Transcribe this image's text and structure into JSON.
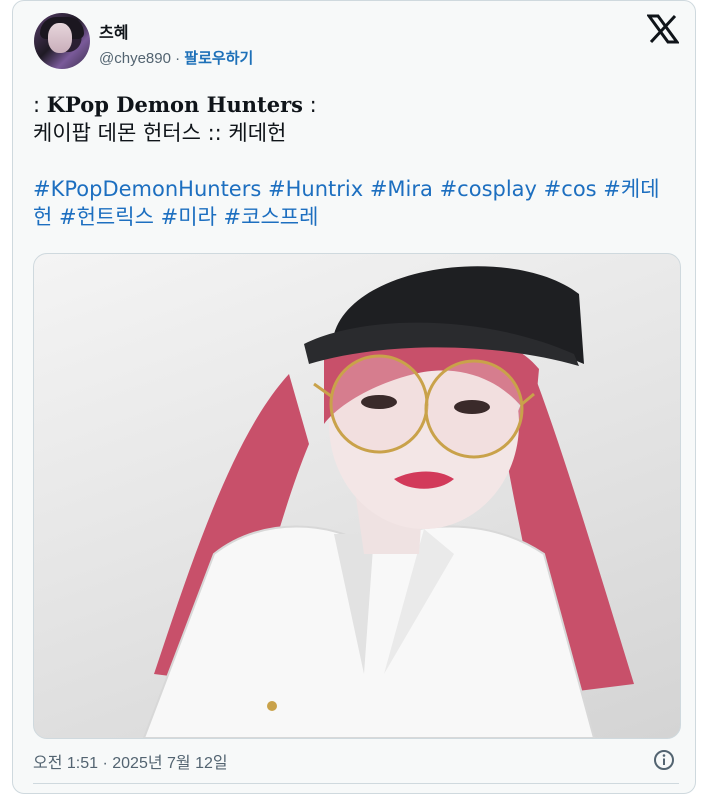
{
  "user": {
    "name": "츠혜",
    "handle": "@chye890",
    "separator": "·",
    "follow_label": "팔로우하기"
  },
  "tweet": {
    "line1_prefix": ": ",
    "line1_title": "KPop Demon Hunters",
    "line1_suffix": " :",
    "line2": "케이팝 데몬 헌터스 :: 케데헌",
    "hashtags_line1": [
      "#KPopDemonHunters",
      "#Huntrix",
      "#Mira",
      "#cosplay",
      "#cos",
      "#케데"
    ],
    "hashtags_line2": [
      "헌",
      "#헌트릭스",
      "#미라",
      "#코스프레"
    ]
  },
  "footer": {
    "timestamp": "오전 1:51 · 2025년 7월 12일"
  },
  "icons": {
    "logo": "x-logo-icon",
    "info": "info-icon"
  },
  "colors": {
    "link": "#1d6fc0",
    "text": "#0f1419",
    "muted": "#536471",
    "card_bg": "#f7f9f9"
  }
}
